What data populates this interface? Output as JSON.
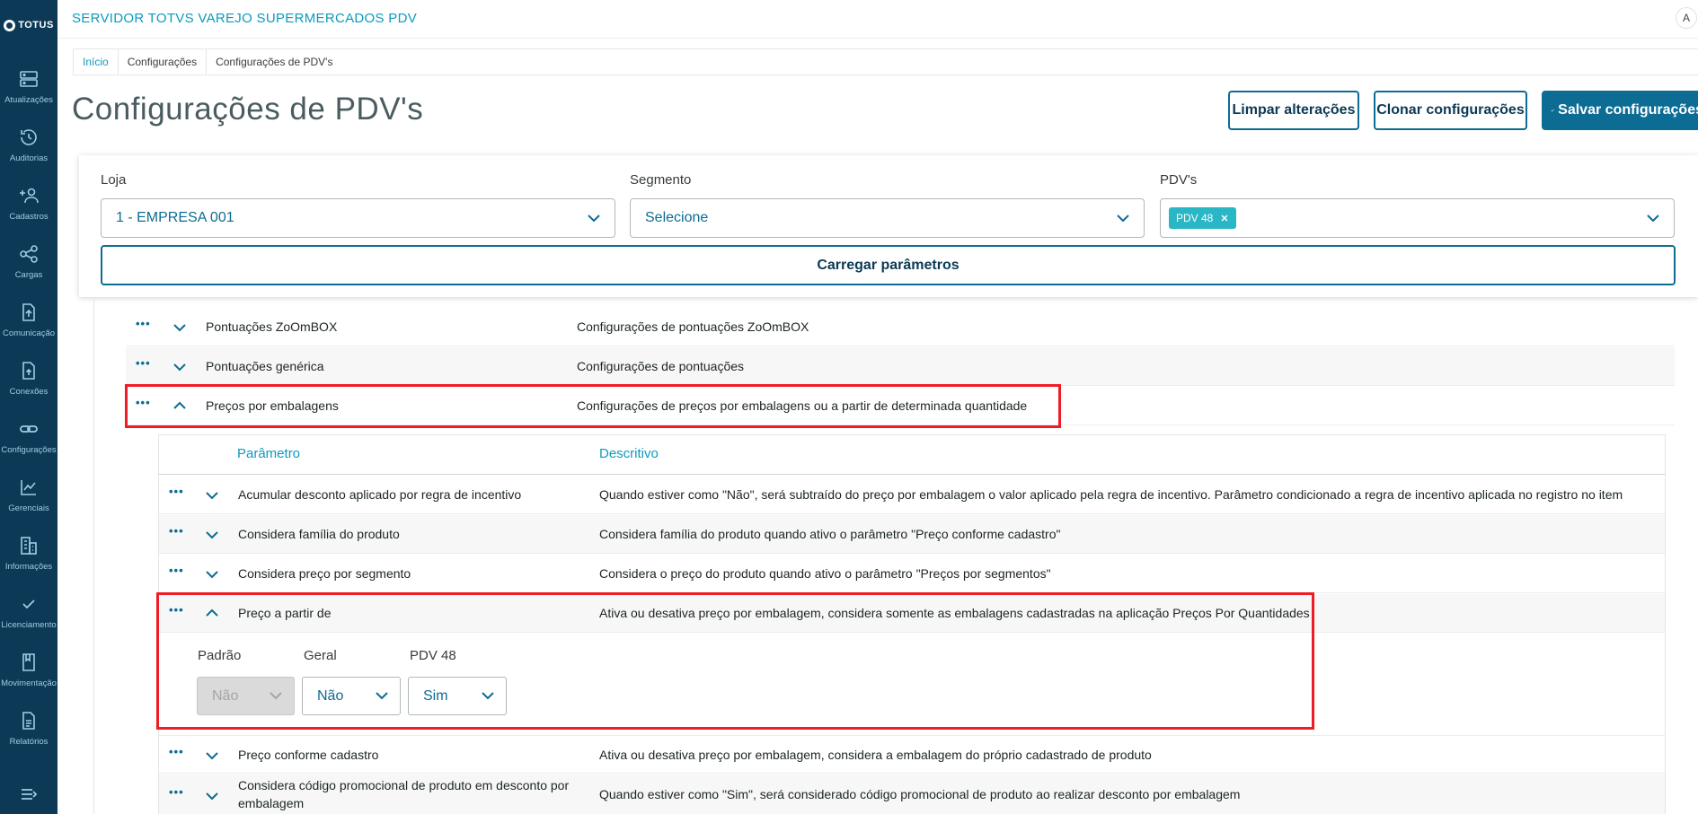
{
  "app": {
    "logo_text": "TOTUS",
    "title": "SERVIDOR TOTVS VAREJO SUPERMERCADOS PDV",
    "avatar": "A"
  },
  "sidebar": {
    "items": [
      {
        "label": "Atualizações",
        "icon": "server-icon"
      },
      {
        "label": "Auditorias",
        "icon": "history-icon"
      },
      {
        "label": "Cadastros",
        "icon": "add-user-icon"
      },
      {
        "label": "Cargas",
        "icon": "share-icon"
      },
      {
        "label": "Comunicação",
        "icon": "upload-file-icon"
      },
      {
        "label": "Conexões",
        "icon": "connection-file-icon"
      },
      {
        "label": "Configurações",
        "icon": "link-icon"
      },
      {
        "label": "Gerenciais",
        "icon": "chart-icon"
      },
      {
        "label": "Informações",
        "icon": "building-icon"
      },
      {
        "label": "Licenciamento",
        "icon": "check-icon"
      },
      {
        "label": "Movimentação",
        "icon": "book-icon"
      },
      {
        "label": "Relatórios",
        "icon": "report-icon"
      }
    ],
    "collapse_icon": "collapse-menu-icon"
  },
  "breadcrumb": [
    "Início",
    "Configurações",
    "Configurações de PDV's"
  ],
  "page": {
    "title": "Configurações de PDV's",
    "clear_label": "Limpar alterações",
    "clone_label": "Clonar configurações",
    "save_label": "Salvar configurações"
  },
  "filters": {
    "store_label": "Loja",
    "store_value": "1 - EMPRESA 001",
    "segment_label": "Segmento",
    "segment_value": "Selecione",
    "pdv_label": "PDV's",
    "pdv_tag": "PDV 48",
    "load_label": "Carregar parâmetros"
  },
  "groups": [
    {
      "name": "Pontuações ZoOmBOX",
      "desc": "Configurações de pontuações ZoOmBOX",
      "expanded": false
    },
    {
      "name": "Pontuações genérica",
      "desc": "Configurações de pontuações",
      "expanded": false
    },
    {
      "name": "Preços por embalagens",
      "desc": "Configurações de preços por embalagens ou a partir de determinada quantidade",
      "expanded": true
    }
  ],
  "params_table": {
    "col_param": "Parâmetro",
    "col_desc": "Descritivo",
    "rows": [
      {
        "name": "Acumular desconto aplicado por regra de incentivo",
        "desc": "Quando estiver como \"Não\", será subtraído do preço por embalagem o valor aplicado pela regra de incentivo. Parâmetro condicionado a regra de incentivo aplicada no registro no item"
      },
      {
        "name": "Considera família do produto",
        "desc": "Considera família do produto quando ativo o parâmetro \"Preço conforme cadastro\""
      },
      {
        "name": "Considera preço por segmento",
        "desc": "Considera o preço do produto quando ativo o parâmetro \"Preços por segmentos\""
      },
      {
        "name": "Preço a partir de",
        "desc": "Ativa ou desativa preço por embalagem, considera somente as embalagens cadastradas na aplicação Preços Por Quantidades"
      },
      {
        "name": "Preço conforme cadastro",
        "desc": "Ativa ou desativa preço por embalagem, considera a embalagem do próprio cadastrado de produto"
      },
      {
        "name_line1": "Considera código promocional de produto em desconto por",
        "name_line2": "embalagem",
        "desc": "Quando estiver como \"Sim\", será considerado código promocional de produto ao realizar desconto por embalagem"
      }
    ]
  },
  "expanded_param": {
    "default_label": "Padrão",
    "default_value": "Não",
    "general_label": "Geral",
    "general_value": "Não",
    "pdv_label": "PDV 48",
    "pdv_value": "Sim"
  },
  "colors": {
    "sidebar": "#0c3955",
    "primary": "#0c6c94",
    "link": "#0c9abe",
    "tag": "#29b6c5",
    "highlight": "#ee1c25"
  }
}
